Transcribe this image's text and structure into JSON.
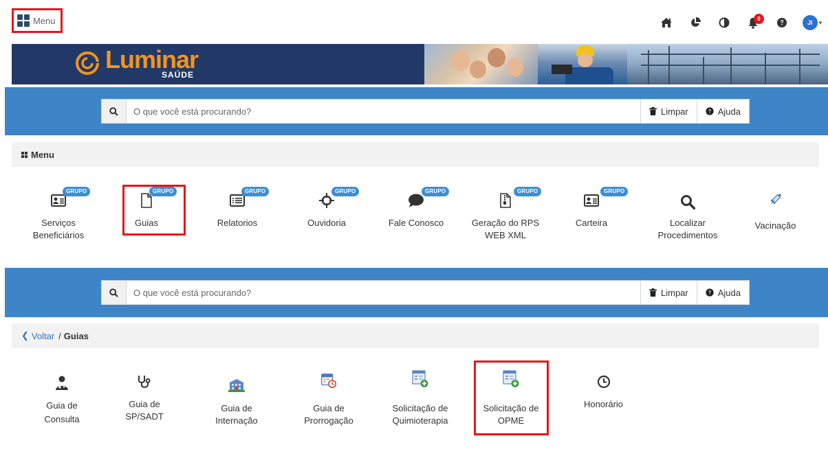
{
  "topbar": {
    "menu_label": "Menu",
    "notifications_count": "0",
    "avatar_initials": "JI",
    "icons": [
      "home-icon",
      "pie-chart-icon",
      "contrast-icon",
      "bell-icon",
      "help-icon",
      "avatar"
    ]
  },
  "banner": {
    "brand_name": "Luminar",
    "brand_sub": "SAÚDE",
    "colors": {
      "background": "#223968",
      "brand": "#f3941d"
    }
  },
  "search1": {
    "placeholder": "O que você está procurando?",
    "clear_label": "Limpar",
    "help_label": "Ajuda"
  },
  "search2": {
    "placeholder": "O que você está procurando?",
    "clear_label": "Limpar",
    "help_label": "Ajuda"
  },
  "menu_section": {
    "title": "Menu",
    "badge_label": "GRUPO",
    "items": [
      {
        "label_1": "Serviços",
        "label_2": "Beneficiários",
        "icon": "id-card-icon",
        "grupo": true
      },
      {
        "label_1": "Guias",
        "label_2": "",
        "icon": "document-icon",
        "grupo": true
      },
      {
        "label_1": "Relatorios",
        "label_2": "",
        "icon": "list-icon",
        "grupo": true
      },
      {
        "label_1": "Ouvidoria",
        "label_2": "",
        "icon": "crosshairs-icon",
        "grupo": true
      },
      {
        "label_1": "Fale Conosco",
        "label_2": "",
        "icon": "chat-icon",
        "grupo": true
      },
      {
        "label_1": "Geração do RPS",
        "label_2": "WEB XML",
        "icon": "zip-file-icon",
        "grupo": true
      },
      {
        "label_1": "Carteira",
        "label_2": "",
        "icon": "id-card-icon",
        "grupo": true
      },
      {
        "label_1": "Localizar",
        "label_2": "Procedimentos",
        "icon": "search-icon",
        "grupo": false
      },
      {
        "label_1": "Vacinação",
        "label_2": "",
        "icon": "syringe-icon",
        "grupo": false
      }
    ]
  },
  "breadcrumb": {
    "back_label": "Voltar",
    "separator": "/",
    "current": "Guias"
  },
  "guias_section": {
    "items": [
      {
        "label_1": "Guia de",
        "label_2": "Consulta",
        "icon": "doctor-icon"
      },
      {
        "label_1": "Guia de",
        "label_2": "SP/SADT",
        "icon": "stethoscope-icon"
      },
      {
        "label_1": "Guia de",
        "label_2": "Internação",
        "icon": "hospital-icon"
      },
      {
        "label_1": "Guia de",
        "label_2": "Prorrogação",
        "icon": "calendar-clock-icon"
      },
      {
        "label_1": "Solicitação de",
        "label_2": "Quimioterapia",
        "icon": "form-add-icon"
      },
      {
        "label_1": "Solicitação de",
        "label_2": "OPME",
        "icon": "form-add-icon"
      },
      {
        "label_1": "Honorário",
        "label_2": "",
        "icon": "clock-icon"
      }
    ]
  },
  "colors": {
    "search_band": "#3d85c6",
    "highlight": "#e8141a",
    "grupo_badge": "#3b8fd8",
    "link": "#2d72c4"
  }
}
